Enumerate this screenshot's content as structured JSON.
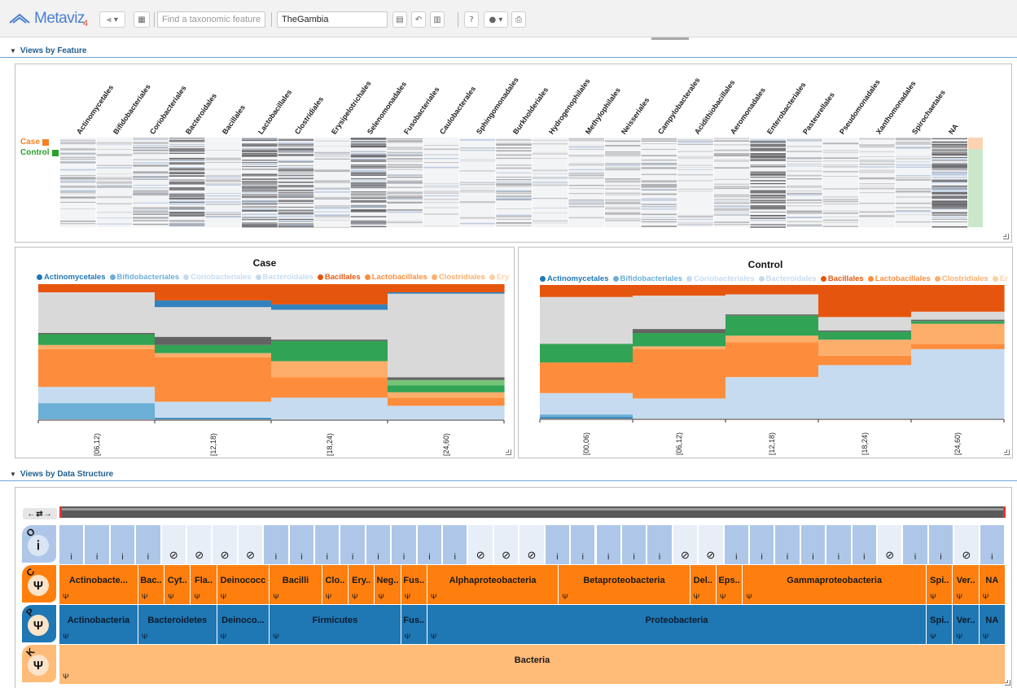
{
  "app": {
    "logo_text": "Metaviz",
    "logo_version": "4",
    "search_placeholder": "Find a taxonomic feature",
    "workspace_name": "TheGambia",
    "views_by_feature": "Views by Feature",
    "views_by_data_structure": "Views by Data Structure"
  },
  "colors": {
    "case": "#f58220",
    "control": "#2ca02c",
    "heatmap_dark": "#a4a4a4",
    "icicle_class": "#ff7f0e",
    "icicle_phylum": "#1f77b4",
    "icicle_kingdom": "#ffbb78",
    "icicle_leaf": "#aec7e8"
  },
  "heatmap": {
    "legend": [
      {
        "label": "Case",
        "color": "#f58220"
      },
      {
        "label": "Control",
        "color": "#2ca02c"
      }
    ],
    "columns": [
      "Actinomycetales",
      "Bifidobacteriales",
      "Coriobacteriales",
      "Bacteroidales",
      "Bacillales",
      "Lactobacillales",
      "Clostridiales",
      "Erysipelotrichales",
      "Selenomonadales",
      "Fusobacteriales",
      "Caulobacterales",
      "Sphingomonadales",
      "Burkholderiales",
      "Hydrogenophilales",
      "Methylophilales",
      "Neisseriales",
      "Campylobacterales",
      "Acidithiobacillales",
      "Aeromonadales",
      "Enterobacteriales",
      "Pasteurellales",
      "Pseudomonadales",
      "Xanthomonadales",
      "Spirochaetales",
      "NA"
    ],
    "column_density": [
      0.35,
      0.2,
      0.45,
      0.9,
      0.2,
      0.9,
      0.85,
      0.25,
      0.95,
      0.4,
      0.1,
      0.1,
      0.35,
      0.1,
      0.2,
      0.3,
      0.4,
      0.15,
      0.3,
      0.9,
      0.3,
      0.2,
      0.2,
      0.25,
      1.0
    ]
  },
  "chart_data": [
    {
      "type": "area",
      "title": "Case",
      "categories": [
        "[06,12)",
        "[12,18)",
        "[18,24)",
        "[24,60)"
      ],
      "legend": [
        "Actinomycetales",
        "Bifidobacteriales",
        "Coriobacteriales",
        "Bacteroidales",
        "Bacillales",
        "Lactobacillales",
        "Clostridiales",
        "Ery"
      ],
      "series": [
        {
          "name": "Actinomycetales",
          "color": "#1f77b4",
          "values": [
            0.0,
            0.01,
            0.0,
            0.0
          ]
        },
        {
          "name": "Bifidobacteriales",
          "color": "#6baed6",
          "values": [
            0.12,
            0.0,
            0.0,
            0.0
          ]
        },
        {
          "name": "Coriobacteriales",
          "color": "#c6dbef",
          "values": [
            0.12,
            0.12,
            0.16,
            0.1
          ]
        },
        {
          "name": "Lactobacillales",
          "color": "#fd8d3c",
          "values": [
            0.28,
            0.33,
            0.15,
            0.06
          ]
        },
        {
          "name": "Clostridiales",
          "color": "#fdae6b",
          "values": [
            0.03,
            0.03,
            0.12,
            0.04
          ]
        },
        {
          "name": "Selenomonadales",
          "color": "#31a354",
          "values": [
            0.08,
            0.06,
            0.15,
            0.05
          ]
        },
        {
          "name": "Enterobacteriales",
          "color": "#74c476",
          "values": [
            0.0,
            0.0,
            0.0,
            0.04
          ]
        },
        {
          "name": "Spirochaetales",
          "color": "#636363",
          "values": [
            0.01,
            0.06,
            0.01,
            0.02
          ]
        },
        {
          "name": "NA",
          "color": "#d9d9d9",
          "values": [
            0.3,
            0.22,
            0.22,
            0.62
          ]
        },
        {
          "name": "Aeromonadales",
          "color": "#3182bd",
          "values": [
            0.0,
            0.05,
            0.04,
            0.01
          ]
        },
        {
          "name": "Bacillales",
          "color": "#e6550d",
          "values": [
            0.06,
            0.12,
            0.15,
            0.06
          ]
        }
      ]
    },
    {
      "type": "area",
      "title": "Control",
      "categories": [
        "[00,06)",
        "[06,12)",
        "[12,18)",
        "[18,24)",
        "[24,60)"
      ],
      "legend": [
        "Actinomycetales",
        "Bifidobacteriales",
        "Coriobacteriales",
        "Bacteroidales",
        "Bacillales",
        "Lactobacillales",
        "Clostridiales",
        "Er"
      ],
      "series": [
        {
          "name": "Actinomycetales",
          "color": "#1f77b4",
          "values": [
            0.01,
            0.0,
            0.0,
            0.0,
            0.0
          ]
        },
        {
          "name": "Bifidobacteriales",
          "color": "#6baed6",
          "values": [
            0.02,
            0.0,
            0.0,
            0.0,
            0.0
          ]
        },
        {
          "name": "Coriobacteriales",
          "color": "#c6dbef",
          "values": [
            0.16,
            0.15,
            0.31,
            0.4,
            0.52
          ]
        },
        {
          "name": "Lactobacillales",
          "color": "#fd8d3c",
          "values": [
            0.23,
            0.37,
            0.26,
            0.07,
            0.04
          ]
        },
        {
          "name": "Clostridiales",
          "color": "#fdae6b",
          "values": [
            0.0,
            0.02,
            0.05,
            0.12,
            0.15
          ]
        },
        {
          "name": "Selenomonadales",
          "color": "#31a354",
          "values": [
            0.14,
            0.1,
            0.15,
            0.06,
            0.02
          ]
        },
        {
          "name": "Spirochaetales",
          "color": "#636363",
          "values": [
            0.0,
            0.03,
            0.01,
            0.01,
            0.01
          ]
        },
        {
          "name": "NA",
          "color": "#d9d9d9",
          "values": [
            0.35,
            0.25,
            0.15,
            0.1,
            0.06
          ]
        },
        {
          "name": "Aeromonadales",
          "color": "#3182bd",
          "values": [
            0.0,
            0.0,
            0.0,
            0.0,
            0.0
          ]
        },
        {
          "name": "Bacillales",
          "color": "#e6550d",
          "values": [
            0.09,
            0.08,
            0.07,
            0.24,
            0.2
          ]
        }
      ]
    }
  ],
  "icicle": {
    "level_letters": [
      "O",
      "C",
      "P",
      "K"
    ],
    "class": [
      {
        "label": "Actinobacte...",
        "span": 3
      },
      {
        "label": "Bac..",
        "span": 1
      },
      {
        "label": "Cyt..",
        "span": 1
      },
      {
        "label": "Fla..",
        "span": 1
      },
      {
        "label": "Deinococc",
        "span": 2
      },
      {
        "label": "Bacilli",
        "span": 2
      },
      {
        "label": "Clo..",
        "span": 1
      },
      {
        "label": "Ery..",
        "span": 1
      },
      {
        "label": "Neg..",
        "span": 1
      },
      {
        "label": "Fus..",
        "span": 1
      },
      {
        "label": "Alphaproteobacteria",
        "span": 5
      },
      {
        "label": "Betaproteobacteria",
        "span": 5
      },
      {
        "label": "Del..",
        "span": 1
      },
      {
        "label": "Eps..",
        "span": 1
      },
      {
        "label": "Gammaproteobacteria",
        "span": 7
      },
      {
        "label": "Spi..",
        "span": 1
      },
      {
        "label": "Ver..",
        "span": 1
      },
      {
        "label": "NA",
        "span": 1
      }
    ],
    "phylum": [
      {
        "label": "Actinobacteria",
        "span": 3
      },
      {
        "label": "Bacteroidetes",
        "span": 3
      },
      {
        "label": "Deinoco...",
        "span": 2
      },
      {
        "label": "Firmicutes",
        "span": 5
      },
      {
        "label": "Fus..",
        "span": 1
      },
      {
        "label": "Proteobacteria",
        "span": 19
      },
      {
        "label": "Spi..",
        "span": 1
      },
      {
        "label": "Ver..",
        "span": 1
      },
      {
        "label": "NA",
        "span": 1
      }
    ],
    "kingdom": [
      {
        "label": "Bacteria",
        "span": 36
      }
    ],
    "leaves": [
      "s",
      "s",
      "s",
      "s",
      "n",
      "n",
      "n",
      "n",
      "s",
      "s",
      "s",
      "s",
      "s",
      "s",
      "s",
      "s",
      "n",
      "n",
      "n",
      "s",
      "s",
      "s",
      "s",
      "s",
      "n",
      "n",
      "s",
      "s",
      "s",
      "s",
      "s",
      "s",
      "n",
      "s",
      "s",
      "n",
      "s"
    ]
  }
}
